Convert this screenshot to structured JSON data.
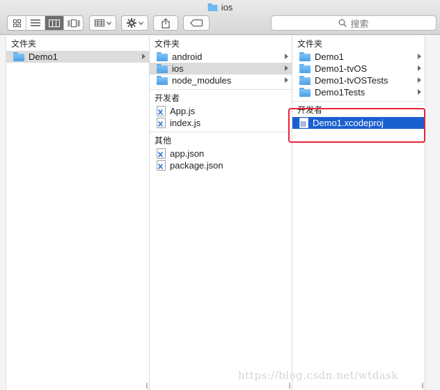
{
  "window": {
    "title": "ios"
  },
  "toolbar": {
    "view_modes": [
      "icon-view-icon",
      "list-view-icon",
      "column-view-icon",
      "coverflow-view-icon"
    ],
    "active_view": 2,
    "group_icon": "group-grid-icon",
    "action_icon": "gear-icon",
    "share_icon": "share-icon",
    "tag_icon": "tag-icon"
  },
  "search": {
    "placeholder": "搜索",
    "icon": "search-icon"
  },
  "columns": [
    {
      "groups": [
        {
          "header": "文件夹",
          "items": [
            {
              "label": "Demo1",
              "type": "folder",
              "selected": "gray",
              "has_children": true
            }
          ]
        }
      ]
    },
    {
      "groups": [
        {
          "header": "文件夹",
          "items": [
            {
              "label": "android",
              "type": "folder",
              "has_children": true
            },
            {
              "label": "ios",
              "type": "folder",
              "selected": "gray",
              "has_children": true
            },
            {
              "label": "node_modules",
              "type": "folder",
              "has_children": true
            }
          ]
        },
        {
          "header": "开发者",
          "items": [
            {
              "label": "App.js",
              "type": "doc"
            },
            {
              "label": "index.js",
              "type": "doc"
            }
          ]
        },
        {
          "header": "其他",
          "items": [
            {
              "label": "app.json",
              "type": "doc"
            },
            {
              "label": "package.json",
              "type": "doc"
            }
          ]
        }
      ]
    },
    {
      "groups": [
        {
          "header": "文件夹",
          "items": [
            {
              "label": "Demo1",
              "type": "folder",
              "has_children": true
            },
            {
              "label": "Demo1-tvOS",
              "type": "folder",
              "has_children": true
            },
            {
              "label": "Demo1-tvOSTests",
              "type": "folder",
              "has_children": true
            },
            {
              "label": "Demo1Tests",
              "type": "folder",
              "has_children": true
            }
          ]
        },
        {
          "header": "开发者",
          "items": [
            {
              "label": "Demo1.xcodeproj",
              "type": "xcodeproj",
              "selected": "blue"
            }
          ]
        }
      ]
    }
  ],
  "highlight_color": "#e8203a",
  "selection_color": "#1a5fd0",
  "watermark": "https://blog.csdn.net/wtdask"
}
